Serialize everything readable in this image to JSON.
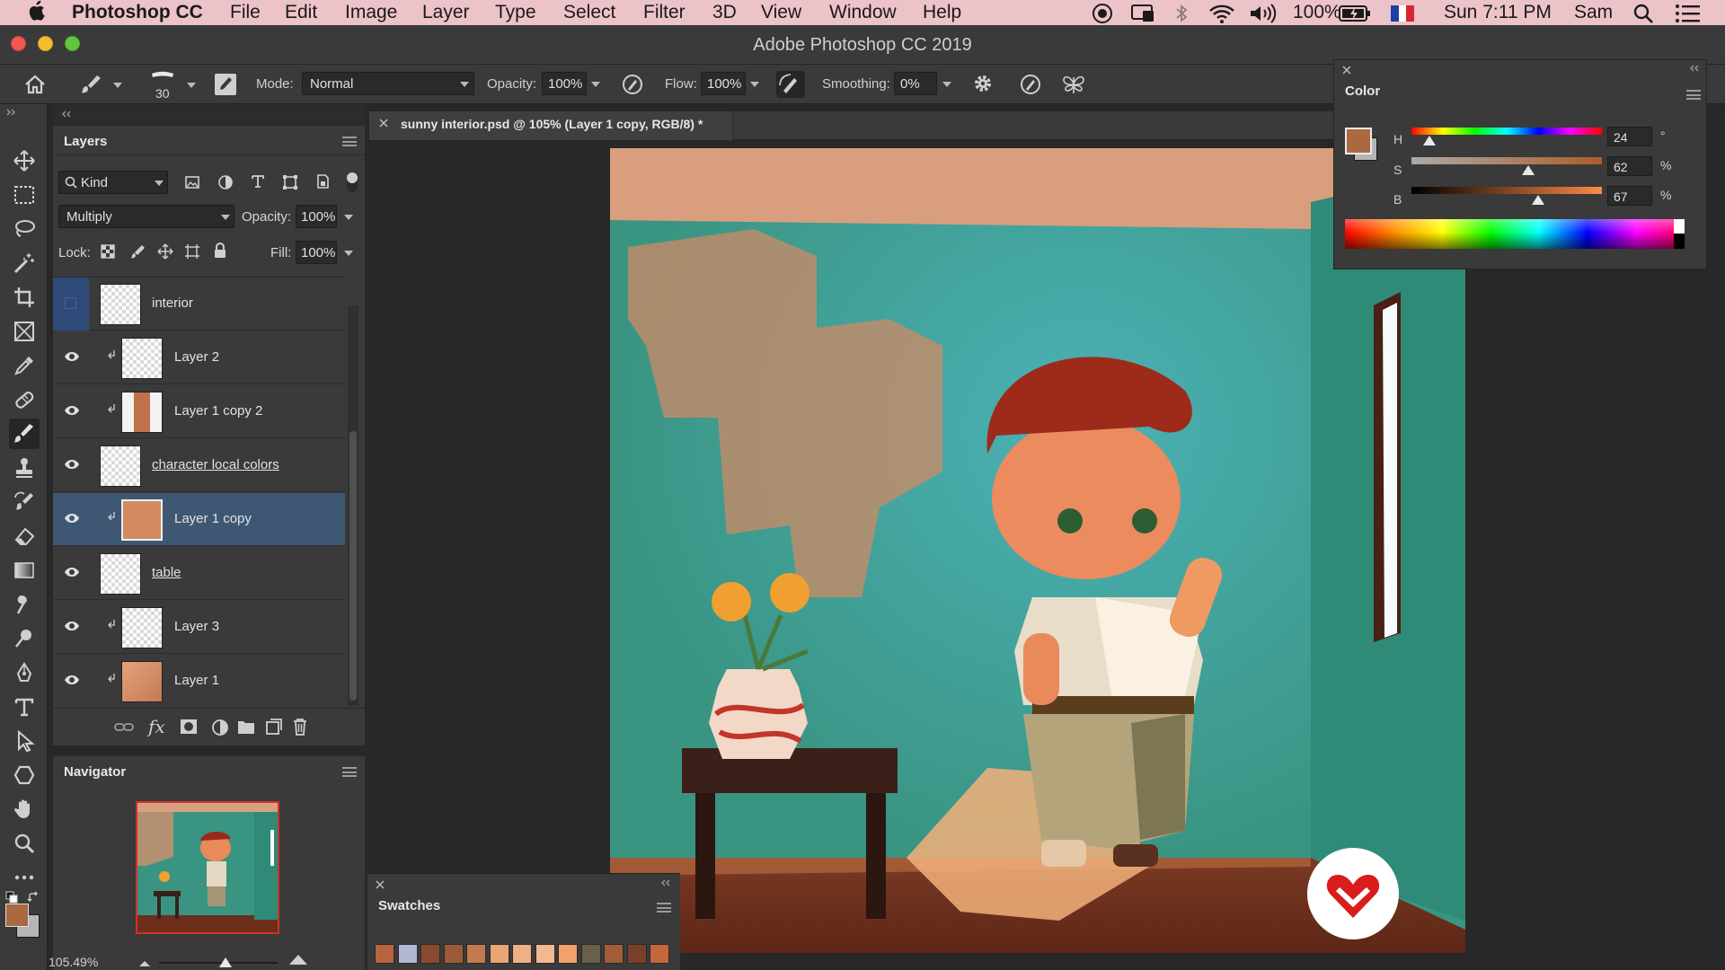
{
  "menubar": {
    "app_name": "Photoshop CC",
    "menus": [
      "File",
      "Edit",
      "Image",
      "Layer",
      "Type",
      "Select",
      "Filter",
      "3D",
      "View",
      "Window",
      "Help"
    ],
    "battery": "100%",
    "clock": "Sun 7:11 PM",
    "user": "Sam"
  },
  "window": {
    "title": "Adobe Photoshop CC 2019"
  },
  "options_bar": {
    "brush_size": "30",
    "mode_label": "Mode:",
    "mode_value": "Normal",
    "opacity_label": "Opacity:",
    "opacity_value": "100%",
    "flow_label": "Flow:",
    "flow_value": "100%",
    "smoothing_label": "Smoothing:",
    "smoothing_value": "0%"
  },
  "layers_panel": {
    "title": "Layers",
    "filter_kind": "Kind",
    "blend_mode": "Multiply",
    "opacity_label": "Opacity:",
    "opacity_value": "100%",
    "lock_label": "Lock:",
    "fill_label": "Fill:",
    "fill_value": "100%",
    "layers": [
      {
        "name": "interior",
        "visible": false,
        "clipped": false,
        "underlined": false,
        "selected": false
      },
      {
        "name": "Layer 2",
        "visible": true,
        "clipped": true,
        "underlined": false,
        "selected": false
      },
      {
        "name": "Layer 1 copy 2",
        "visible": true,
        "clipped": true,
        "underlined": false,
        "selected": false
      },
      {
        "name": "character local colors",
        "visible": true,
        "clipped": false,
        "underlined": true,
        "selected": false
      },
      {
        "name": "Layer 1 copy",
        "visible": true,
        "clipped": true,
        "underlined": false,
        "selected": true
      },
      {
        "name": "table",
        "visible": true,
        "clipped": false,
        "underlined": true,
        "selected": false
      },
      {
        "name": "Layer 3",
        "visible": true,
        "clipped": true,
        "underlined": false,
        "selected": false
      },
      {
        "name": "Layer 1",
        "visible": true,
        "clipped": true,
        "underlined": false,
        "selected": false
      }
    ]
  },
  "navigator": {
    "title": "Navigator",
    "zoom": "105.49%"
  },
  "document": {
    "tab_title": "sunny interior.psd @ 105% (Layer 1 copy, RGB/8) *"
  },
  "swatches": {
    "title": "Swatches",
    "colors": [
      "#b8643e",
      "#b4b6d6",
      "#8a4a2e",
      "#9c5a3a",
      "#c47a50",
      "#e9a575",
      "#f0b084",
      "#f2b98e",
      "#f4a06a",
      "#6a6048",
      "#a15c3a",
      "#7a3f28",
      "#c4683c"
    ]
  },
  "color_panel": {
    "title": "Color",
    "foreground": "#ab6841",
    "background": "#b5b5b5",
    "h_label": "H",
    "s_label": "S",
    "b_label": "B",
    "h_value": "24",
    "s_value": "62",
    "b_value": "67",
    "h_unit": "°",
    "s_unit": "%",
    "b_unit": "%"
  },
  "colors": {
    "menubar_bg": "#ecc3c8",
    "panel_bg": "#3a3a3a",
    "selection": "#3e5873",
    "wall": "#3c9c8c",
    "floor": "#6e2e1c"
  }
}
